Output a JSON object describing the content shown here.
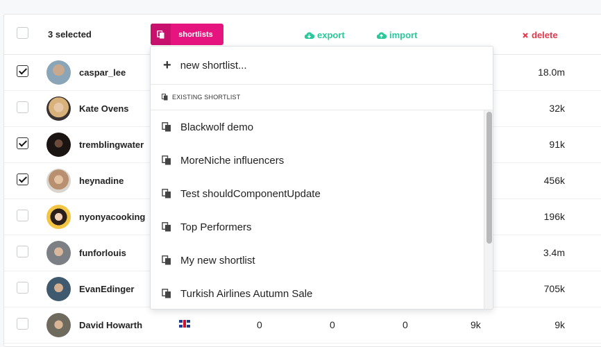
{
  "header": {
    "selected_text": "3 selected",
    "shortlists_label": "shortlists",
    "export_label": "export",
    "import_label": "import",
    "delete_label": "delete"
  },
  "colors": {
    "accent": "#e6147f",
    "export": "#2cc79a",
    "delete": "#e63a4e"
  },
  "rows": [
    {
      "name": "caspar_lee",
      "checked": true,
      "reach": "18.0m"
    },
    {
      "name": "Kate Ovens",
      "checked": false,
      "reach": "32k"
    },
    {
      "name": "tremblingwater",
      "checked": true,
      "reach": "91k"
    },
    {
      "name": "heynadine",
      "checked": true,
      "reach": "456k"
    },
    {
      "name": "nyonyacooking",
      "checked": false,
      "reach": "196k"
    },
    {
      "name": "funforlouis",
      "checked": false,
      "reach": "3.4m"
    },
    {
      "name": "EvanEdinger",
      "checked": false,
      "reach": "705k"
    },
    {
      "name": "David Howarth",
      "checked": false,
      "reach": "9k",
      "flag": "uk-flag",
      "col1": "0",
      "col2": "0",
      "col3": "0",
      "col4": "9k"
    }
  ],
  "dropdown": {
    "new_label": "new shortlist...",
    "section_label": "EXISTING SHORTLIST",
    "items": [
      "Blackwolf demo",
      "MoreNiche influencers",
      "Test shouldComponentUpdate",
      "Top Performers",
      "My new shortlist",
      "Turkish Airlines Autumn Sale"
    ]
  }
}
